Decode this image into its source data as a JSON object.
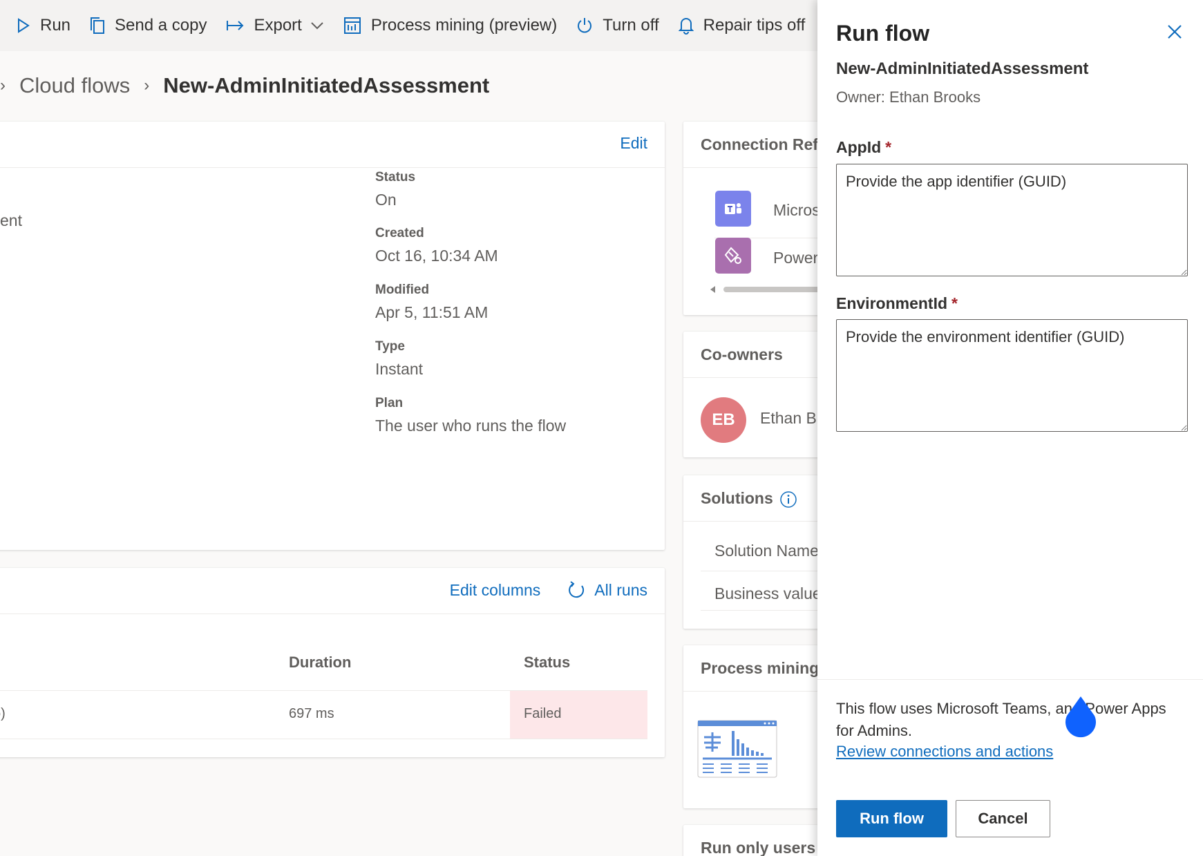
{
  "toolbar": {
    "items": [
      {
        "label": "Run",
        "icon": "play-icon"
      },
      {
        "label": "Send a copy",
        "icon": "copy-icon"
      },
      {
        "label": "Export",
        "icon": "export-icon"
      },
      {
        "label": "Process mining (preview)",
        "icon": "process-mining-icon"
      },
      {
        "label": "Turn off",
        "icon": "power-icon"
      },
      {
        "label": "Repair tips off",
        "icon": "bell-icon"
      }
    ]
  },
  "breadcrumb": {
    "parent": "Cloud flows",
    "current": "New-AdminInitiatedAssessment"
  },
  "details": {
    "edit_label": "Edit",
    "name_fragment": "ent",
    "fields": [
      {
        "label": "Status",
        "value": "On"
      },
      {
        "label": "Created",
        "value": "Oct 16, 10:34 AM"
      },
      {
        "label": "Modified",
        "value": "Apr 5, 11:51 AM"
      },
      {
        "label": "Type",
        "value": "Instant"
      },
      {
        "label": "Plan",
        "value": "The user who runs the flow"
      }
    ]
  },
  "runs": {
    "edit_columns_label": "Edit columns",
    "all_runs_label": "All runs",
    "columns": [
      "Duration",
      "Status"
    ],
    "rows": [
      {
        "start_fragment": "o)",
        "duration": "697 ms",
        "status": "Failed"
      }
    ]
  },
  "connection_refs": {
    "title": "Connection Refe",
    "items": [
      {
        "name": "Micros",
        "icon": "teams-icon",
        "color": "#7b83eb"
      },
      {
        "name": "Power",
        "icon": "power-apps-icon",
        "color": "#a96fae"
      }
    ]
  },
  "co_owners": {
    "title": "Co-owners",
    "initials": "EB",
    "name": "Ethan Br",
    "avatar_color": "#e17b7f"
  },
  "solutions": {
    "title": "Solutions",
    "rows": [
      "Solution Name",
      "Business value"
    ]
  },
  "process_mining": {
    "title": "Process mining"
  },
  "run_only_users": {
    "title": "Run only users"
  },
  "panel": {
    "title": "Run flow",
    "flow_name": "New-AdminInitiatedAssessment",
    "owner": "Owner: Ethan Brooks",
    "appid_label": "AppId",
    "appid_placeholder": "Provide the app identifier (GUID)",
    "envid_label": "EnvironmentId",
    "envid_placeholder": "Provide the environment identifier (GUID)",
    "required_mark": "*",
    "footer_text": "This flow uses Microsoft Teams, and Power Apps for Admins.",
    "review_link": "Review connections and actions",
    "run_button": "Run flow",
    "cancel_button": "Cancel"
  },
  "colors": {
    "accent": "#0f6cbd",
    "failed_bg": "#fde7e9",
    "required": "#a4262c"
  }
}
